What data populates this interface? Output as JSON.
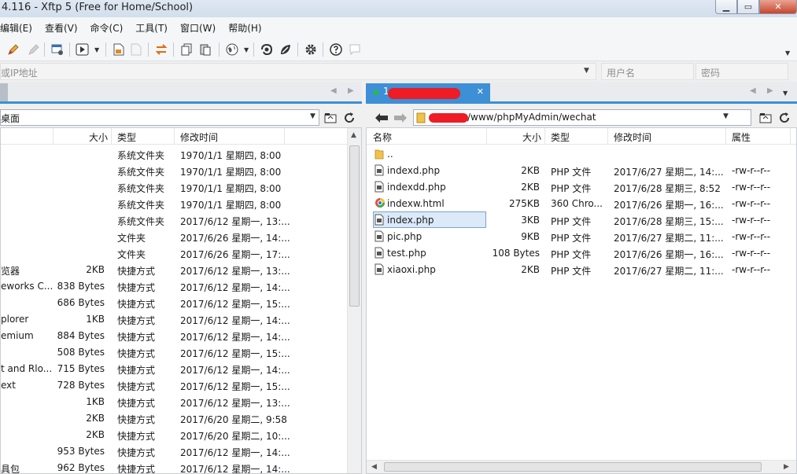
{
  "window": {
    "title": "4.116  - Xftp 5 (Free for Home/School)",
    "min": "▁",
    "max": "▭",
    "close": "✕"
  },
  "menu": [
    "编辑(E)",
    "查看(V)",
    "命令(C)",
    "工具(T)",
    "窗口(W)",
    "帮助(H)"
  ],
  "address": {
    "host_placeholder": "或IP地址",
    "user_placeholder": "用户名",
    "password_placeholder": "密码"
  },
  "local": {
    "path": "桌面",
    "columns": {
      "name": "",
      "size": "大小",
      "type": "类型",
      "modified": "修改时间"
    },
    "rows": [
      {
        "name": "",
        "size": "",
        "type": "系统文件夹",
        "modified": "1970/1/1 星期四, 8:00"
      },
      {
        "name": "",
        "size": "",
        "type": "系统文件夹",
        "modified": "1970/1/1 星期四, 8:00"
      },
      {
        "name": "",
        "size": "",
        "type": "系统文件夹",
        "modified": "1970/1/1 星期四, 8:00"
      },
      {
        "name": "",
        "size": "",
        "type": "系统文件夹",
        "modified": "1970/1/1 星期四, 8:00"
      },
      {
        "name": "",
        "size": "",
        "type": "系统文件夹",
        "modified": "2017/6/12 星期一, 13:..."
      },
      {
        "name": "",
        "size": "",
        "type": "文件夹",
        "modified": "2017/6/26 星期一, 14:..."
      },
      {
        "name": "",
        "size": "",
        "type": "文件夹",
        "modified": "2017/6/26 星期一, 17:..."
      },
      {
        "name": "览器",
        "size": "2KB",
        "type": "快捷方式",
        "modified": "2017/6/12 星期一, 13:..."
      },
      {
        "name": "eworks C...",
        "size": "838 Bytes",
        "type": "快捷方式",
        "modified": "2017/6/12 星期一, 14:..."
      },
      {
        "name": "",
        "size": "686 Bytes",
        "type": "快捷方式",
        "modified": "2017/6/12 星期一, 15:..."
      },
      {
        "name": "plorer",
        "size": "1KB",
        "type": "快捷方式",
        "modified": "2017/6/12 星期一, 14:..."
      },
      {
        "name": "emium",
        "size": "884 Bytes",
        "type": "快捷方式",
        "modified": "2017/6/12 星期一, 14:..."
      },
      {
        "name": "",
        "size": "508 Bytes",
        "type": "快捷方式",
        "modified": "2017/6/12 星期一, 15:..."
      },
      {
        "name": "t and Rlo...",
        "size": "715 Bytes",
        "type": "快捷方式",
        "modified": "2017/6/12 星期一, 14:..."
      },
      {
        "name": "ext",
        "size": "728 Bytes",
        "type": "快捷方式",
        "modified": "2017/6/12 星期一, 15:..."
      },
      {
        "name": "",
        "size": "1KB",
        "type": "快捷方式",
        "modified": "2017/6/12 星期一, 13:..."
      },
      {
        "name": "",
        "size": "2KB",
        "type": "快捷方式",
        "modified": "2017/6/20 星期二, 9:58"
      },
      {
        "name": "",
        "size": "2KB",
        "type": "快捷方式",
        "modified": "2017/6/20 星期二, 10:..."
      },
      {
        "name": "",
        "size": "953 Bytes",
        "type": "快捷方式",
        "modified": "2017/6/12 星期一, 14:..."
      },
      {
        "name": "具包",
        "size": "962 Bytes",
        "type": "快捷方式",
        "modified": "2017/6/12 星期一, 14:..."
      }
    ]
  },
  "remote": {
    "tab_label": "1",
    "path": "/www/phpMyAdmin/wechat",
    "columns": {
      "name": "名称",
      "size": "大小",
      "type": "类型",
      "modified": "修改时间",
      "perm": "属性"
    },
    "rows": [
      {
        "name": "..",
        "size": "",
        "type": "",
        "modified": "",
        "perm": "",
        "icon": "folder-icon"
      },
      {
        "name": "indexd.php",
        "size": "2KB",
        "type": "PHP 文件",
        "modified": "2017/6/27 星期二, 14:...",
        "perm": "-rw-r--r--",
        "icon": "php-file-icon"
      },
      {
        "name": "indexdd.php",
        "size": "2KB",
        "type": "PHP 文件",
        "modified": "2017/6/28 星期三, 8:52",
        "perm": "-rw-r--r--",
        "icon": "php-file-icon"
      },
      {
        "name": "indexw.html",
        "size": "275KB",
        "type": "360 Chro...",
        "modified": "2017/6/26 星期一, 16:...",
        "perm": "-rw-r--r--",
        "icon": "html-file-icon"
      },
      {
        "name": "index.php",
        "size": "3KB",
        "type": "PHP 文件",
        "modified": "2017/6/28 星期三, 15:...",
        "perm": "-rw-r--r--",
        "icon": "php-file-icon"
      },
      {
        "name": "pic.php",
        "size": "9KB",
        "type": "PHP 文件",
        "modified": "2017/6/27 星期二, 11:...",
        "perm": "-rw-r--r--",
        "icon": "php-file-icon"
      },
      {
        "name": "test.php",
        "size": "108 Bytes",
        "type": "PHP 文件",
        "modified": "2017/6/26 星期一, 16:...",
        "perm": "-rw-r--r--",
        "icon": "php-file-icon"
      },
      {
        "name": "xiaoxi.php",
        "size": "2KB",
        "type": "PHP 文件",
        "modified": "2017/6/27 星期二, 11:...",
        "perm": "-rw-r--r--",
        "icon": "php-file-icon"
      }
    ],
    "selected_index": 4
  },
  "colors": {
    "accent": "#3d8fd6",
    "selection": "#dbe9f8",
    "redaction": "#ee1c24"
  }
}
